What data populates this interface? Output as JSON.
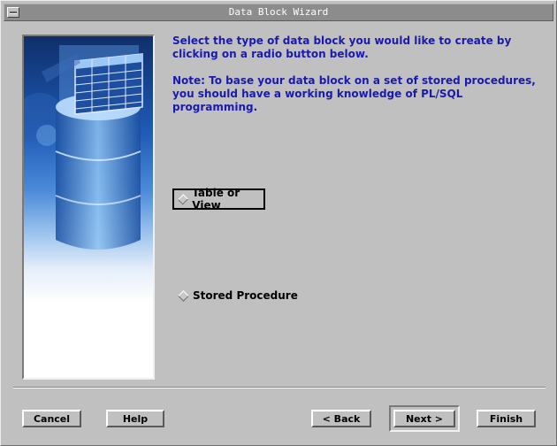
{
  "window": {
    "title": "Data Block Wizard"
  },
  "instructions": {
    "paragraph1": "Select the type of data block you would like to create by clicking on a radio button below.",
    "paragraph2": "Note: To base your data block on a set of stored procedures, you should have a working knowledge of PL/SQL programming."
  },
  "options": {
    "table_or_view": "Table or View",
    "stored_procedure": "Stored Procedure",
    "selected": "Table or View"
  },
  "buttons": {
    "cancel": "Cancel",
    "help": "Help",
    "back": "< Back",
    "next": "Next >",
    "finish": "Finish"
  },
  "colors": {
    "instruction_text": "#1a1ab0",
    "title_bar": "#8c8c8c",
    "dialog_background": "#c0c0c0"
  },
  "icons": {
    "window_menu": "window-menu-icon",
    "illustration": "database-table-illustration"
  }
}
